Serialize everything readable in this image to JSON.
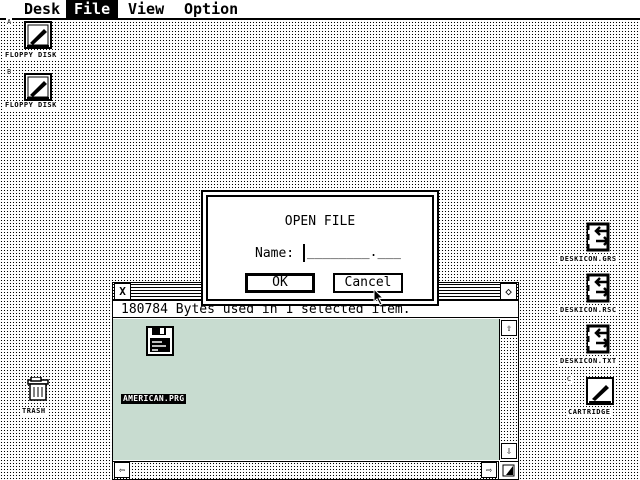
{
  "menubar": {
    "items": [
      {
        "label": "Desk",
        "active": false
      },
      {
        "label": "File",
        "active": true
      },
      {
        "label": "View",
        "active": false
      },
      {
        "label": "Option",
        "active": false
      }
    ]
  },
  "desktop": {
    "drive_a": {
      "letter": "A",
      "label": "FLOPPY DISK",
      "icon": "floppy-disk-icon"
    },
    "drive_b": {
      "letter": "B",
      "label": "FLOPPY DISK",
      "icon": "floppy-disk-icon"
    },
    "trash": {
      "label": "TRASH",
      "icon": "trash-icon"
    },
    "right_icons": [
      {
        "label": "DESKICON.GRS",
        "icon": "file-transfer-icon"
      },
      {
        "label": "DESKICON.RSC",
        "icon": "file-transfer-icon"
      },
      {
        "label": "DESKICON.TXT",
        "icon": "file-transfer-icon"
      }
    ],
    "cartridge": {
      "letter": "C",
      "label": "CARTRIDGE",
      "icon": "cartridge-icon"
    }
  },
  "window": {
    "close_glyph": "X",
    "full_glyph": "◇",
    "info_text": "180784 Bytes used in 1 selected item.",
    "file": {
      "label": "AMERICAN.PRG",
      "icon": "program-file-icon"
    }
  },
  "dialog": {
    "title": "OPEN FILE",
    "name_label": "Name:",
    "name_template": "________.___",
    "ok_label": "OK",
    "cancel_label": "Cancel"
  },
  "colors": {
    "foreground": "#000000",
    "background": "#ffffff",
    "window_fill": "#e8f6ee"
  }
}
